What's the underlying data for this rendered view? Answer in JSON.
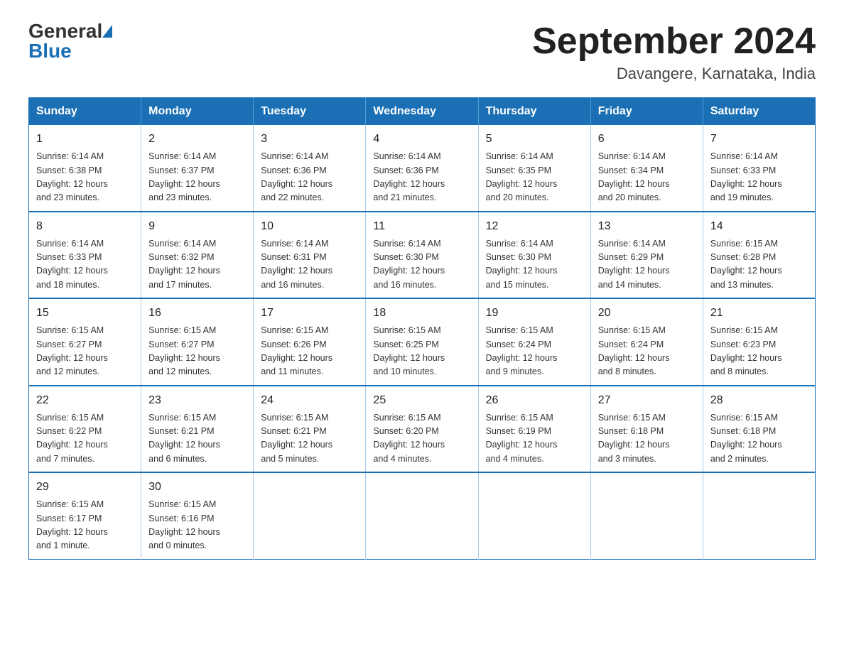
{
  "header": {
    "logo_general": "General",
    "logo_blue": "Blue",
    "month_title": "September 2024",
    "location": "Davangere, Karnataka, India"
  },
  "calendar": {
    "days_of_week": [
      "Sunday",
      "Monday",
      "Tuesday",
      "Wednesday",
      "Thursday",
      "Friday",
      "Saturday"
    ],
    "weeks": [
      [
        {
          "day": "1",
          "sunrise": "6:14 AM",
          "sunset": "6:38 PM",
          "daylight": "12 hours and 23 minutes."
        },
        {
          "day": "2",
          "sunrise": "6:14 AM",
          "sunset": "6:37 PM",
          "daylight": "12 hours and 23 minutes."
        },
        {
          "day": "3",
          "sunrise": "6:14 AM",
          "sunset": "6:36 PM",
          "daylight": "12 hours and 22 minutes."
        },
        {
          "day": "4",
          "sunrise": "6:14 AM",
          "sunset": "6:36 PM",
          "daylight": "12 hours and 21 minutes."
        },
        {
          "day": "5",
          "sunrise": "6:14 AM",
          "sunset": "6:35 PM",
          "daylight": "12 hours and 20 minutes."
        },
        {
          "day": "6",
          "sunrise": "6:14 AM",
          "sunset": "6:34 PM",
          "daylight": "12 hours and 20 minutes."
        },
        {
          "day": "7",
          "sunrise": "6:14 AM",
          "sunset": "6:33 PM",
          "daylight": "12 hours and 19 minutes."
        }
      ],
      [
        {
          "day": "8",
          "sunrise": "6:14 AM",
          "sunset": "6:33 PM",
          "daylight": "12 hours and 18 minutes."
        },
        {
          "day": "9",
          "sunrise": "6:14 AM",
          "sunset": "6:32 PM",
          "daylight": "12 hours and 17 minutes."
        },
        {
          "day": "10",
          "sunrise": "6:14 AM",
          "sunset": "6:31 PM",
          "daylight": "12 hours and 16 minutes."
        },
        {
          "day": "11",
          "sunrise": "6:14 AM",
          "sunset": "6:30 PM",
          "daylight": "12 hours and 16 minutes."
        },
        {
          "day": "12",
          "sunrise": "6:14 AM",
          "sunset": "6:30 PM",
          "daylight": "12 hours and 15 minutes."
        },
        {
          "day": "13",
          "sunrise": "6:14 AM",
          "sunset": "6:29 PM",
          "daylight": "12 hours and 14 minutes."
        },
        {
          "day": "14",
          "sunrise": "6:15 AM",
          "sunset": "6:28 PM",
          "daylight": "12 hours and 13 minutes."
        }
      ],
      [
        {
          "day": "15",
          "sunrise": "6:15 AM",
          "sunset": "6:27 PM",
          "daylight": "12 hours and 12 minutes."
        },
        {
          "day": "16",
          "sunrise": "6:15 AM",
          "sunset": "6:27 PM",
          "daylight": "12 hours and 12 minutes."
        },
        {
          "day": "17",
          "sunrise": "6:15 AM",
          "sunset": "6:26 PM",
          "daylight": "12 hours and 11 minutes."
        },
        {
          "day": "18",
          "sunrise": "6:15 AM",
          "sunset": "6:25 PM",
          "daylight": "12 hours and 10 minutes."
        },
        {
          "day": "19",
          "sunrise": "6:15 AM",
          "sunset": "6:24 PM",
          "daylight": "12 hours and 9 minutes."
        },
        {
          "day": "20",
          "sunrise": "6:15 AM",
          "sunset": "6:24 PM",
          "daylight": "12 hours and 8 minutes."
        },
        {
          "day": "21",
          "sunrise": "6:15 AM",
          "sunset": "6:23 PM",
          "daylight": "12 hours and 8 minutes."
        }
      ],
      [
        {
          "day": "22",
          "sunrise": "6:15 AM",
          "sunset": "6:22 PM",
          "daylight": "12 hours and 7 minutes."
        },
        {
          "day": "23",
          "sunrise": "6:15 AM",
          "sunset": "6:21 PM",
          "daylight": "12 hours and 6 minutes."
        },
        {
          "day": "24",
          "sunrise": "6:15 AM",
          "sunset": "6:21 PM",
          "daylight": "12 hours and 5 minutes."
        },
        {
          "day": "25",
          "sunrise": "6:15 AM",
          "sunset": "6:20 PM",
          "daylight": "12 hours and 4 minutes."
        },
        {
          "day": "26",
          "sunrise": "6:15 AM",
          "sunset": "6:19 PM",
          "daylight": "12 hours and 4 minutes."
        },
        {
          "day": "27",
          "sunrise": "6:15 AM",
          "sunset": "6:18 PM",
          "daylight": "12 hours and 3 minutes."
        },
        {
          "day": "28",
          "sunrise": "6:15 AM",
          "sunset": "6:18 PM",
          "daylight": "12 hours and 2 minutes."
        }
      ],
      [
        {
          "day": "29",
          "sunrise": "6:15 AM",
          "sunset": "6:17 PM",
          "daylight": "12 hours and 1 minute."
        },
        {
          "day": "30",
          "sunrise": "6:15 AM",
          "sunset": "6:16 PM",
          "daylight": "12 hours and 0 minutes."
        },
        null,
        null,
        null,
        null,
        null
      ]
    ]
  }
}
